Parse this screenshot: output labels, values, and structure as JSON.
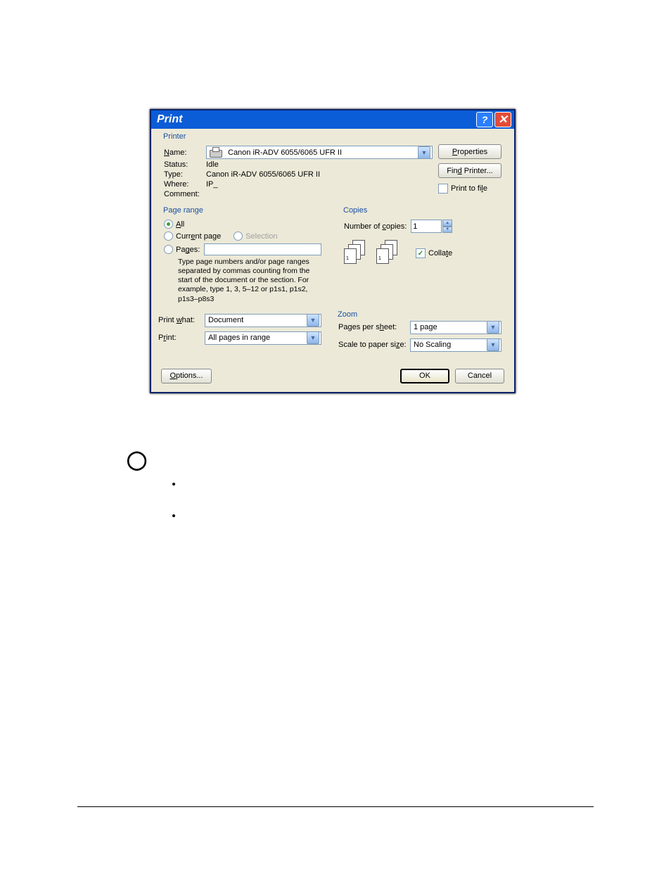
{
  "dialog": {
    "title": "Print",
    "printer": {
      "legend": "Printer",
      "name_label": "Name:",
      "name_value": "Canon iR-ADV 6055/6065 UFR II",
      "status_label": "Status:",
      "status_value": "Idle",
      "type_label": "Type:",
      "type_value": "Canon iR-ADV 6055/6065 UFR II",
      "where_label": "Where:",
      "where_value": "IP_",
      "comment_label": "Comment:",
      "properties_btn": "Properties",
      "find_printer_btn": "Find Printer...",
      "print_to_file": "Print to file"
    },
    "page_range": {
      "legend": "Page range",
      "all": "All",
      "current": "Current page",
      "selection": "Selection",
      "pages": "Pages:",
      "hint": "Type page numbers and/or page ranges separated by commas counting from the start of the document or the section. For example, type 1, 3, 5–12 or p1s1, p1s2, p1s3–p8s3"
    },
    "copies": {
      "legend": "Copies",
      "num_label": "Number of copies:",
      "num_value": "1",
      "collate": "Collate"
    },
    "print_what_label": "Print what:",
    "print_what_value": "Document",
    "print_label": "Print:",
    "print_value": "All pages in range",
    "zoom": {
      "legend": "Zoom",
      "pps_label": "Pages per sheet:",
      "pps_value": "1 page",
      "scale_label": "Scale to paper size:",
      "scale_value": "No Scaling"
    },
    "options_btn": "Options...",
    "ok_btn": "OK",
    "cancel_btn": "Cancel"
  }
}
